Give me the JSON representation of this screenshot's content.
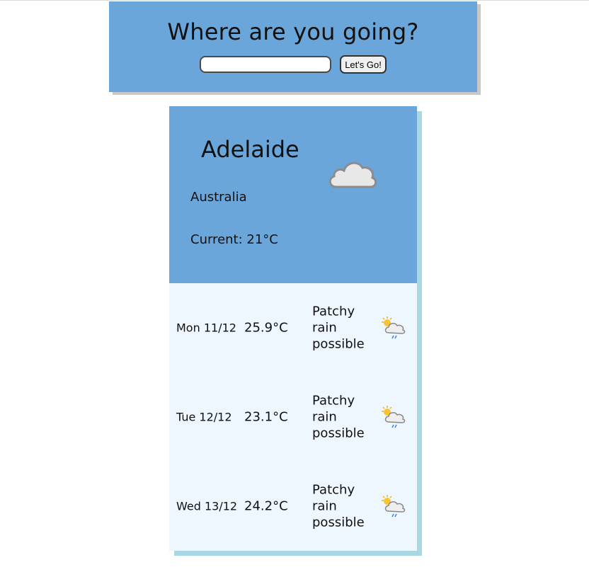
{
  "search": {
    "title": "Where are you going?",
    "input_value": "",
    "placeholder": "",
    "button_label": "Let's Go!"
  },
  "current": {
    "city": "Adelaide",
    "country": "Australia",
    "current_text": "Current: 21°C",
    "icon": "cloud-icon"
  },
  "forecast": [
    {
      "date": "Mon 11/12",
      "temp": "25.9°C",
      "condition": "Patchy rain possible",
      "icon": "patchy-rain-icon"
    },
    {
      "date": "Tue 12/12",
      "temp": "23.1°C",
      "condition": "Patchy rain possible",
      "icon": "patchy-rain-icon"
    },
    {
      "date": "Wed 13/12",
      "temp": "24.2°C",
      "condition": "Patchy rain possible",
      "icon": "patchy-rain-icon"
    }
  ],
  "colors": {
    "panel_blue": "#6aa6da",
    "forecast_bg": "#eef6fe",
    "card_shadow": "#a9d8e4"
  }
}
